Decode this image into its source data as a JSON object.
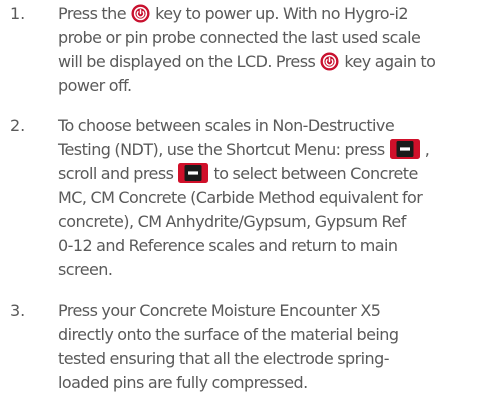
{
  "steps": [
    {
      "number": "1.",
      "lines": [
        [
          "Press the ",
          {
            "icon": "power-button-icon"
          },
          " key to power up. With no Hygro-i2"
        ],
        [
          "probe  or pin probe connected the last used scale"
        ],
        [
          "will be displayed on the LCD. Press ",
          {
            "icon": "power-button-icon"
          },
          " key again to"
        ],
        [
          "power off."
        ]
      ]
    },
    {
      "number": "2.",
      "lines": [
        [
          "To choose between scales in Non-Destructive"
        ],
        [
          "Testing (NDT), use the Shortcut Menu: press ",
          {
            "icon": "minus-button-icon"
          },
          " ,"
        ],
        [
          "scroll and press ",
          {
            "icon": "minus-button-icon"
          },
          " to select between Concrete"
        ],
        [
          "MC, CM Concrete (Carbide Method equivalent for"
        ],
        [
          "concrete), CM Anhydrite/Gypsum,  Gypsum Ref"
        ],
        [
          "0-12  and Reference scales and return to main"
        ],
        [
          "screen."
        ]
      ]
    },
    {
      "number": "3.",
      "lines": [
        [
          "Press your Concrete Moisture Encounter X5"
        ],
        [
          "directly onto the surface of the material being"
        ],
        [
          "tested ensuring that all the electrode spring-"
        ],
        [
          "loaded pins are fully compressed."
        ]
      ]
    }
  ],
  "colors": {
    "text": "#5a5a5a",
    "power_button": "#c8102e",
    "minus_button_red": "#d0102a",
    "minus_button_black": "#1a1a1a"
  }
}
